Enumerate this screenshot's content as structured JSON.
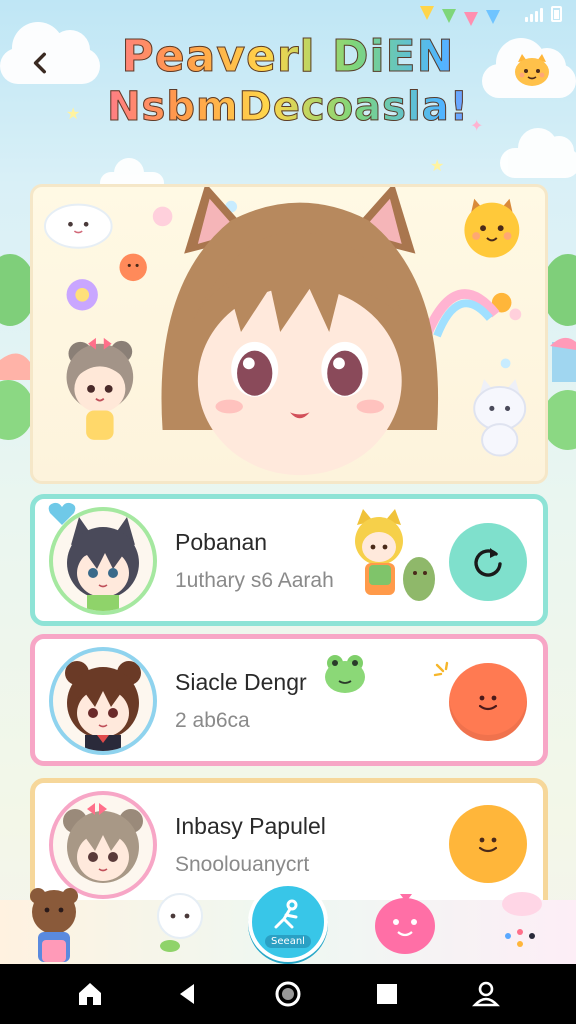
{
  "header": {
    "title_line1": "Peaverl DiEN",
    "title_line2": "NsbmDecoasla!"
  },
  "icons": {
    "back": "chevron-left-icon",
    "refresh": "refresh-icon",
    "search": "search-figure-icon",
    "home": "home-icon",
    "nav_back": "triangle-back-icon",
    "nav_home": "circle-home-icon",
    "recents": "square-recents-icon",
    "profile": "person-icon"
  },
  "colors": {
    "teal_border": "#8ee3d6",
    "pink_border": "#f7a6c6",
    "gold_border": "#f6d79a",
    "refresh_button": "#7fe0cc",
    "orange_button": "#ff7a52",
    "yellow_button": "#ffb63a",
    "search_button": "#38c6e8"
  },
  "cards": [
    {
      "name": "Pobanan",
      "subtitle": "1uthary s6 Aarah"
    },
    {
      "name": "Siacle Dengr",
      "subtitle": "2 ab6ca"
    },
    {
      "name": "Inbasy Papulel",
      "subtitle": "Snoolouanycrt"
    }
  ],
  "dock": {
    "search_label": "Seeanl"
  }
}
